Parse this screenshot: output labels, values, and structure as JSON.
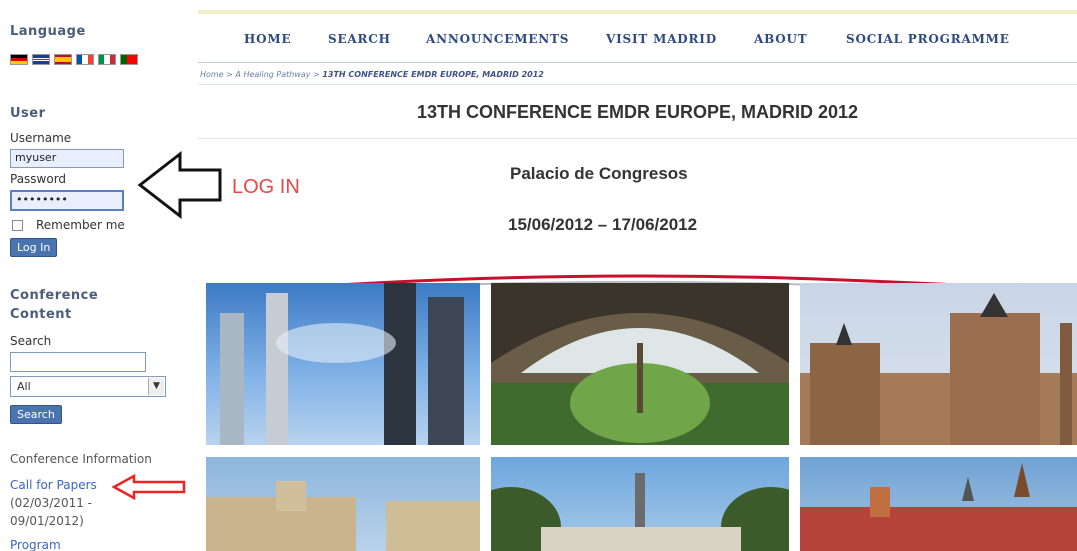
{
  "sidebar": {
    "language_title": "Language",
    "user_title": "User",
    "username_label": "Username",
    "username_value": "myuser",
    "password_label": "Password",
    "password_value": "••••••••",
    "remember_label": "Remember me",
    "login_button": "Log In",
    "content_title_1": "Conference",
    "content_title_2": "Content",
    "search_label": "Search",
    "select_value": "All",
    "search_button": "Search",
    "conf_info": "Conference Information",
    "call_for_papers": "Call for Papers",
    "cfp_dates_1": "(02/03/2011 -",
    "cfp_dates_2": "09/01/2012)",
    "program": "Program"
  },
  "nav": {
    "home": "HOME",
    "search": "SEARCH",
    "announcements": "ANNOUNCEMENTS",
    "visit_madrid": "VISIT MADRID",
    "about": "ABOUT",
    "social": "SOCIAL PROGRAMME"
  },
  "breadcrumb": {
    "home": "Home",
    "sep1": " > ",
    "pathway": "A Healing Pathway",
    "sep2": " > ",
    "current": "13TH CONFERENCE EMDR EUROPE, MADRID 2012"
  },
  "main": {
    "title": "13TH CONFERENCE EMDR EUROPE, MADRID 2012",
    "venue": "Palacio de Congresos",
    "dates": "15/06/2012 – 17/06/2012",
    "annotation": "LOG IN"
  },
  "colors": {
    "nav_text": "#2d4a82",
    "annotation_red": "#e8464a",
    "sidebar_title": "#4a5d7a",
    "link": "#3b66c4"
  }
}
